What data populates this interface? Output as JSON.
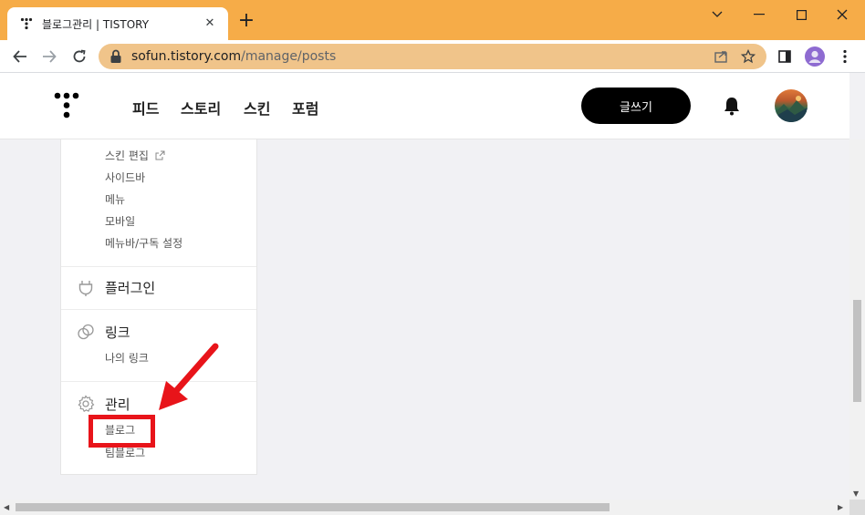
{
  "browser": {
    "tab_title": "블로그관리 | TISTORY",
    "url_host": "sofun.tistory.com",
    "url_path": "/manage/posts",
    "colors": {
      "titlebar": "#f6ac48",
      "omnibox": "#f0c48a"
    }
  },
  "header": {
    "nav": [
      "피드",
      "스토리",
      "스킨",
      "포럼"
    ],
    "write_button": "글쓰기"
  },
  "sidebar": {
    "skin_items": [
      "스킨 편집",
      "사이드바",
      "메뉴",
      "모바일",
      "메뉴바/구독 설정"
    ],
    "plugin": {
      "title": "플러그인",
      "icon": "plug-icon"
    },
    "link": {
      "title": "링크",
      "icon": "link-icon",
      "items": [
        "나의 링크"
      ]
    },
    "manage": {
      "title": "관리",
      "icon": "gear-icon",
      "items": [
        "블로그",
        "팀블로그"
      ]
    }
  },
  "annotation": {
    "highlight_color": "#e8141a"
  }
}
